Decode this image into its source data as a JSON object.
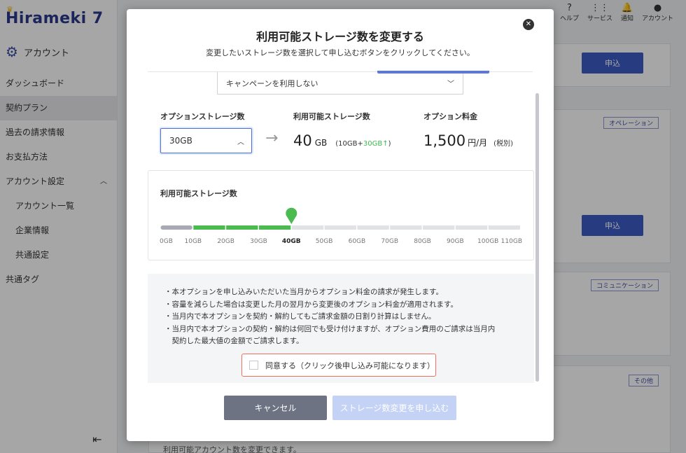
{
  "app": {
    "logo_text": "Hirameki 7",
    "section_title": "アカウント"
  },
  "sidebar": {
    "items": [
      {
        "label": "ダッシュボード",
        "level": 0
      },
      {
        "label": "契約プラン",
        "level": 0,
        "active": true
      },
      {
        "label": "過去の請求情報",
        "level": 0
      },
      {
        "label": "お支払方法",
        "level": 0
      },
      {
        "label": "アカウント設定",
        "level": 0,
        "expanded": true
      },
      {
        "label": "アカウント一覧",
        "level": 1
      },
      {
        "label": "企業情報",
        "level": 1
      },
      {
        "label": "共通設定",
        "level": 1
      },
      {
        "label": "共通タグ",
        "level": 0
      }
    ],
    "collapse_glyph": "⇤"
  },
  "topbar": [
    {
      "icon": "help-icon",
      "glyph": "?",
      "label": "ヘルプ"
    },
    {
      "icon": "grid-icon",
      "glyph": "⋮⋮",
      "label": "サービス"
    },
    {
      "icon": "bell-icon",
      "glyph": "🔔",
      "label": "通知"
    },
    {
      "icon": "user-icon",
      "glyph": "●",
      "label": "アカウント"
    }
  ],
  "background": {
    "apply_label": "申込",
    "tags": [
      "オペレーション",
      "コミュニケーション",
      "その他"
    ],
    "bottom_text": "利用可能アカウント数を変更できます。"
  },
  "modal": {
    "title": "利用可能ストレージ数を変更する",
    "subtitle": "変更したいストレージ数を選択して申し込むボタンをクリックしてください。",
    "campaign_value": "キャンペーンを利用しない",
    "col_option_label": "オプションストレージ数",
    "col_avail_label": "利用可能ストレージ数",
    "col_fee_label": "オプション料金",
    "option_value": "30GB",
    "avail_big": "40",
    "avail_unit": "GB",
    "avail_break_prefix": "(10GB+",
    "avail_break_green": "30GB",
    "avail_break_arrow": "↑",
    "avail_break_suffix": ")",
    "fee_big": "1,500",
    "fee_unit": "円/月",
    "fee_tax": "(税別)",
    "gauge_title": "利用可能ストレージ数",
    "notes": [
      "・本オプションを申し込みいただいた当月からオプション料金の請求が発生します。",
      "・容量を減らした場合は変更した月の翌月から変更後のオプション料金が適用されます。",
      "・当月内で本オプションを契約・解約してもご請求金額の日割り計算はしません。",
      "・当月内で本オプションの契約・解約は何回でも受け付けますが、オプション費用のご請求は当月内",
      "　契約した最大値の金額でご請求します。"
    ],
    "agree_label": "同意する（クリック後申し込み可能になります）",
    "cancel_label": "キャンセル",
    "submit_label": "ストレージ数変更を申し込む"
  },
  "gauge": {
    "ticks": [
      "0GB",
      "10GB",
      "20GB",
      "30GB",
      "40GB",
      "50GB",
      "60GB",
      "70GB",
      "80GB",
      "90GB",
      "100GB",
      "110GB"
    ],
    "base_gb": 10,
    "option_gb": 30,
    "selected_gb": 40,
    "max_gb": 110,
    "colors": {
      "base": "#a7aab4",
      "option": "#4cbb4f",
      "empty": "#e1e2e5",
      "marker": "#4cbb4f"
    }
  }
}
